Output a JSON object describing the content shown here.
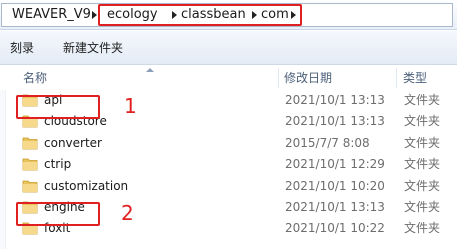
{
  "address": {
    "root": "WEAVER_V9",
    "crumbs": [
      "ecology",
      "classbean",
      "com"
    ]
  },
  "toolbar": {
    "burn_label": "刻录",
    "new_folder_label": "新建文件夹"
  },
  "columns": {
    "name": "名称",
    "modified": "修改日期",
    "type": "类型"
  },
  "files": [
    {
      "name": "api",
      "modified": "2021/10/1 13:13",
      "type": "文件夹"
    },
    {
      "name": "cloudstore",
      "modified": "2021/10/1 13:13",
      "type": "文件夹"
    },
    {
      "name": "converter",
      "modified": "2015/7/7 8:08",
      "type": "文件夹"
    },
    {
      "name": "ctrip",
      "modified": "2021/10/1 12:29",
      "type": "文件夹"
    },
    {
      "name": "customization",
      "modified": "2021/10/1 10:20",
      "type": "文件夹"
    },
    {
      "name": "engine",
      "modified": "2021/10/1 13:13",
      "type": "文件夹"
    },
    {
      "name": "foxit",
      "modified": "2021/10/1 10:22",
      "type": "文件夹"
    }
  ],
  "annotations": {
    "label_1": "1",
    "label_2": "2",
    "color": "#e02020"
  },
  "icons": {
    "folder": "folder-icon",
    "separator": "chevron-right-icon"
  }
}
